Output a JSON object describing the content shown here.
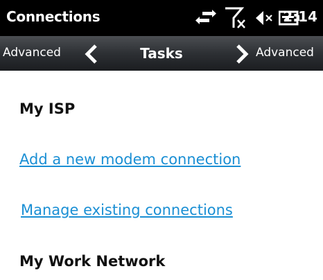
{
  "status_bar": {
    "title": "Connections",
    "time": "2:14",
    "icons": [
      "data-sync-arrows-icon",
      "no-signal-icon",
      "speaker-muted-icon",
      "battery-charging-icon"
    ]
  },
  "nav": {
    "prev_label": "Advanced",
    "current_label": "Tasks",
    "next_label": "Advanced"
  },
  "content": {
    "section1_heading": "My ISP",
    "section1_links": [
      "Add a new modem connection",
      "Manage existing connections"
    ],
    "section2_heading": "My Work Network"
  },
  "colors": {
    "link": "#1a8fd4",
    "status_bar_bg": "#000000",
    "nav_bar_bg": "#2d3034"
  }
}
